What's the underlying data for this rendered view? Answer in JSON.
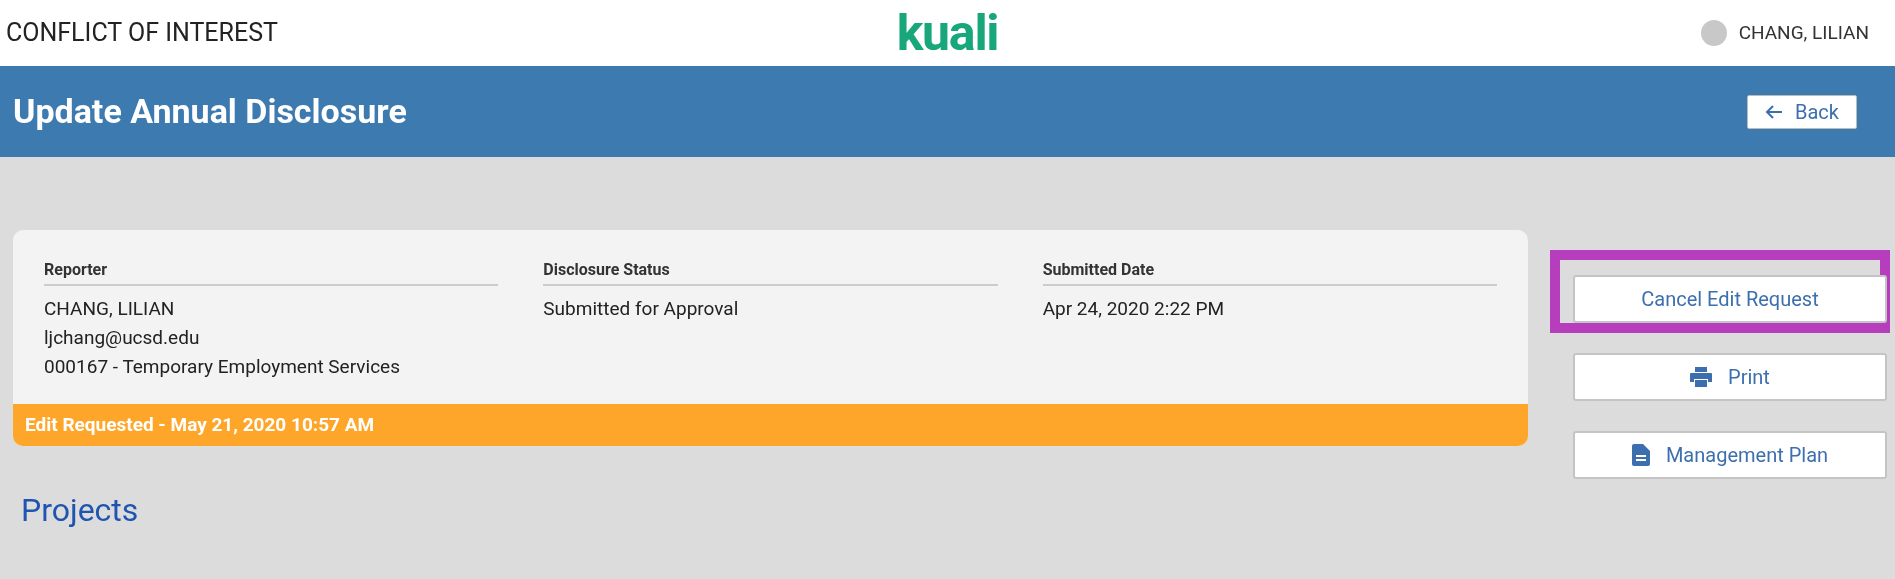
{
  "header": {
    "app_title": "CONFLICT OF INTEREST",
    "logo": "kuali",
    "user_name": "CHANG, LILIAN"
  },
  "title_bar": {
    "title": "Update Annual Disclosure",
    "back_button": "Back"
  },
  "summary": {
    "fields": [
      {
        "label": "Reporter",
        "lines": [
          "CHANG, LILIAN",
          "ljchang@ucsd.edu",
          "000167 - Temporary Employment Services"
        ]
      },
      {
        "label": "Disclosure Status",
        "lines": [
          "Submitted for Approval"
        ]
      },
      {
        "label": "Submitted Date",
        "lines": [
          "Apr 24, 2020 2:22 PM"
        ]
      }
    ],
    "banner": "Edit Requested - May 21, 2020 10:57 AM"
  },
  "actions": [
    {
      "label": "Cancel Edit Request",
      "kind": "plain",
      "highlighted": true
    },
    {
      "label": "Print",
      "kind": "print",
      "highlighted": false
    },
    {
      "label": "Management Plan",
      "kind": "plan",
      "highlighted": false
    }
  ],
  "section_heading": "Projects"
}
